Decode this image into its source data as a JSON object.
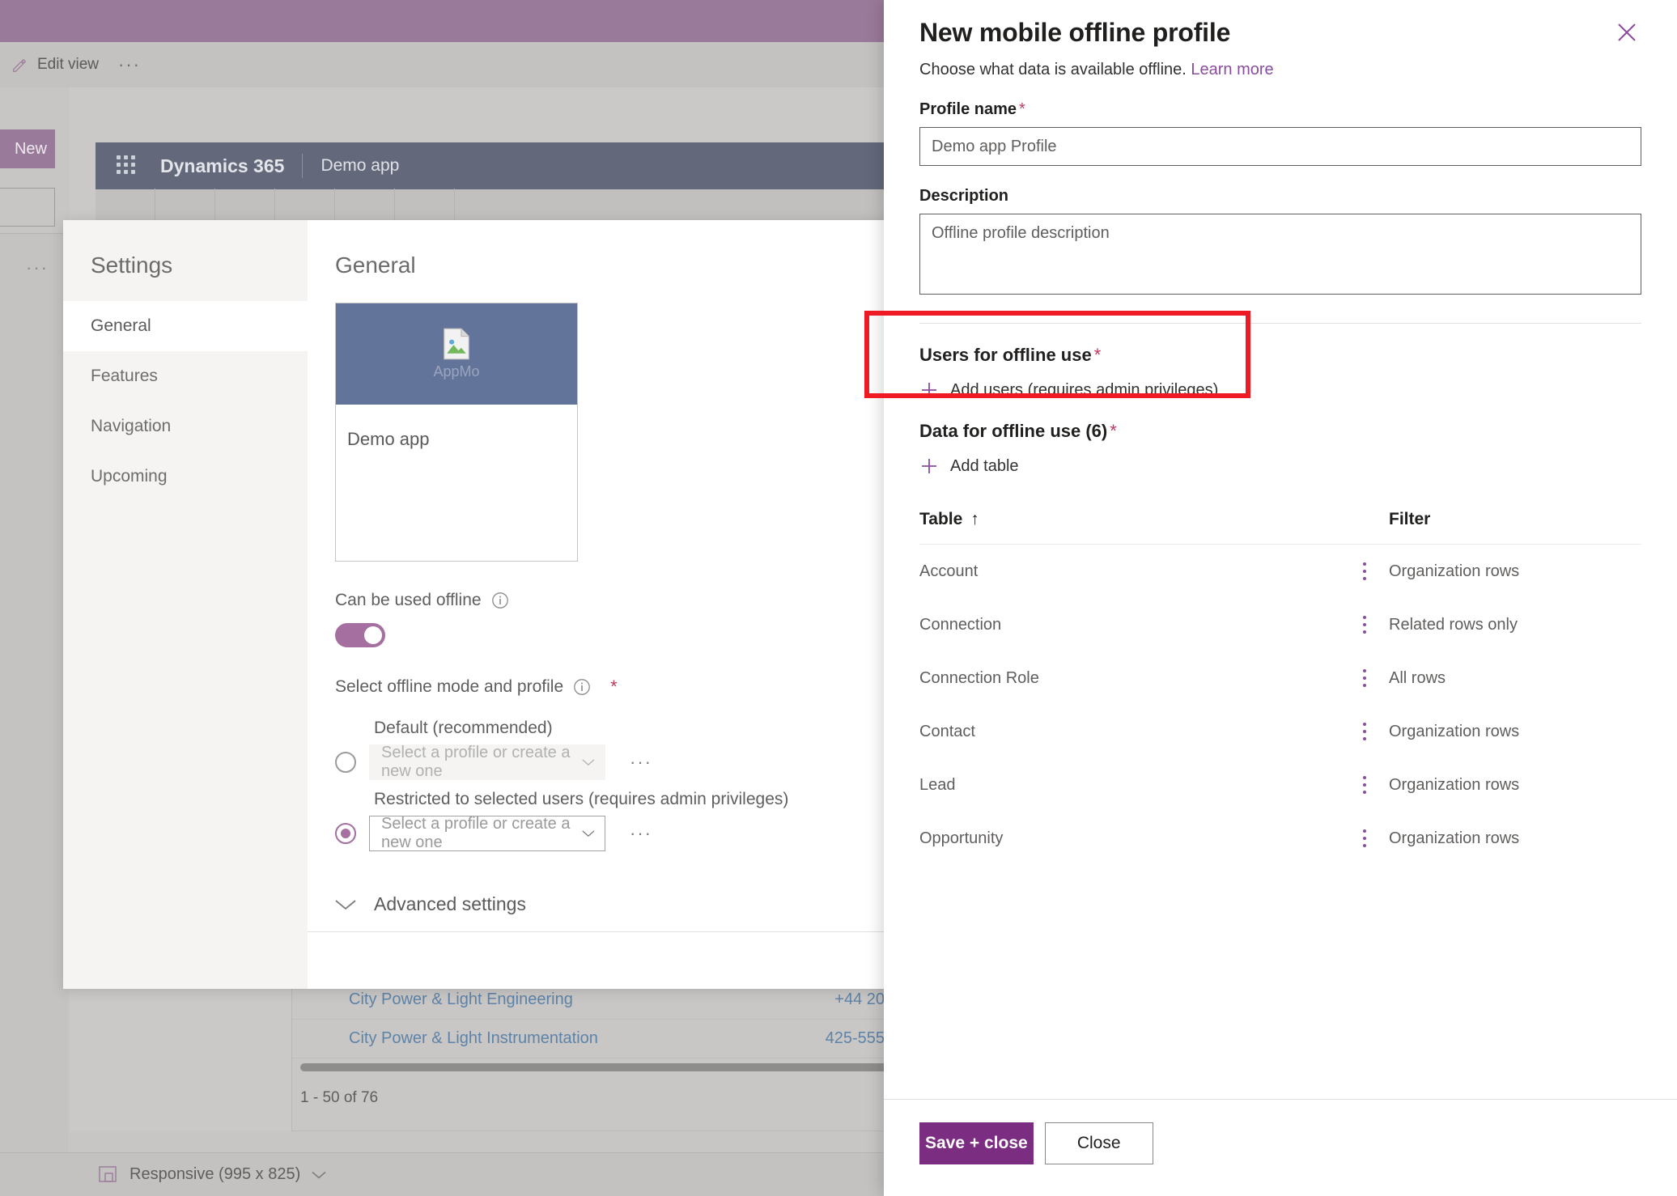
{
  "backdrop": {
    "command_bar": {
      "edit_view_label": "Edit view",
      "overflow_label": "···"
    },
    "new_button_label": "New",
    "left_overflow_label": "···",
    "app_header": {
      "product_name": "Dynamics 365",
      "app_name": "Demo app"
    },
    "grid_rows": [
      {
        "name": "City Power & Light Engineering",
        "phone": "+44 20"
      },
      {
        "name": "City Power & Light Instrumentation",
        "phone": "425-555"
      }
    ],
    "pager_text": "1 - 50 of 76",
    "status_bar": {
      "responsive_label": "Responsive (995 x 825)"
    }
  },
  "settings": {
    "header": "Settings",
    "nav_items": [
      {
        "label": "General",
        "selected": true
      },
      {
        "label": "Features",
        "selected": false
      },
      {
        "label": "Navigation",
        "selected": false
      },
      {
        "label": "Upcoming",
        "selected": false
      }
    ],
    "body_title": "General",
    "app_card": {
      "thumb_alt": "AppMo",
      "name": "Demo app"
    },
    "offline_toggle": {
      "label": "Can be used offline",
      "state": "on"
    },
    "offline_mode": {
      "label": "Select offline mode and profile",
      "required_marker": "*",
      "options": [
        {
          "caption": "Default (recommended)",
          "combo_placeholder": "Select a profile or create a new one",
          "selected": false,
          "disabled": true,
          "overflow_label": "···"
        },
        {
          "caption": "Restricted to selected users (requires admin privileges)",
          "combo_placeholder": "Select a profile or create a new one",
          "selected": true,
          "disabled": false,
          "overflow_label": "···"
        }
      ]
    },
    "advanced_settings_label": "Advanced settings"
  },
  "panel": {
    "title": "New mobile offline profile",
    "subtitle": "Choose what data is available offline.",
    "learn_more": "Learn more",
    "profile_name": {
      "label": "Profile name",
      "required_marker": "*",
      "value": "Demo app Profile"
    },
    "description": {
      "label": "Description",
      "value": "Offline profile description"
    },
    "users_section": {
      "label": "Users for offline use",
      "required_marker": "*",
      "add_label": "Add users (requires admin privileges)"
    },
    "data_section": {
      "label": "Data for offline use (6)",
      "required_marker": "*",
      "add_label": "Add table"
    },
    "table": {
      "columns": [
        "Table",
        "Filter"
      ],
      "sort_indicator": "↑",
      "rows": [
        {
          "table": "Account",
          "filter": "Organization rows"
        },
        {
          "table": "Connection",
          "filter": "Related rows only"
        },
        {
          "table": "Connection Role",
          "filter": "All rows"
        },
        {
          "table": "Contact",
          "filter": "Organization rows"
        },
        {
          "table": "Lead",
          "filter": "Organization rows"
        },
        {
          "table": "Opportunity",
          "filter": "Organization rows"
        }
      ]
    },
    "footer": {
      "save_label": "Save + close",
      "close_label": "Close"
    }
  },
  "colors": {
    "accent_purple": "#7b2d82",
    "link_purple": "#8a4d9e",
    "required_red": "#c0395b",
    "highlight_red": "#ee1b24",
    "toggle_on": "#a5709f",
    "header_navy": "#63697a"
  }
}
